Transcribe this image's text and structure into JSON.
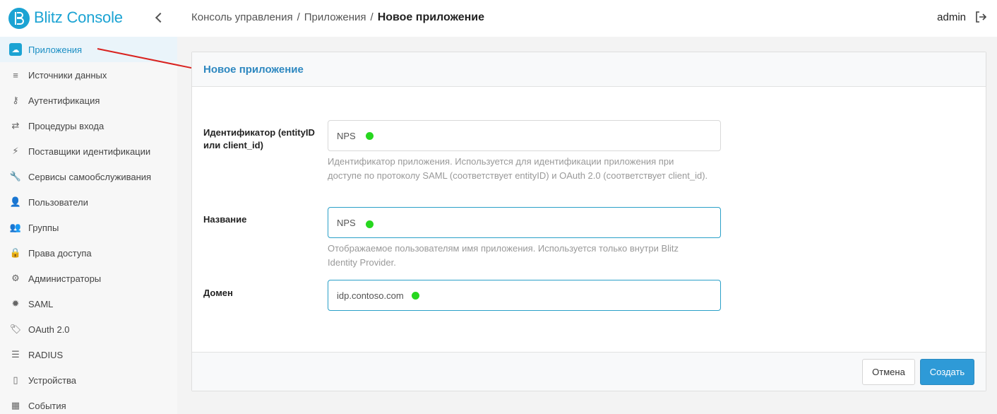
{
  "brand": {
    "name": "Blitz Console"
  },
  "sidebar": {
    "items": [
      {
        "label": "Приложения",
        "icon": "cloud-icon",
        "glyph": "☁",
        "active": true
      },
      {
        "label": "Источники данных",
        "icon": "database-icon",
        "glyph": "≡"
      },
      {
        "label": "Аутентификация",
        "icon": "key-icon",
        "glyph": "⚷"
      },
      {
        "label": "Процедуры входа",
        "icon": "exchange-icon",
        "glyph": "⇄"
      },
      {
        "label": "Поставщики идентификации",
        "icon": "plug-icon",
        "glyph": "⚡"
      },
      {
        "label": "Сервисы самообслуживания",
        "icon": "wrench-icon",
        "glyph": "🔧"
      },
      {
        "label": "Пользователи",
        "icon": "user-icon",
        "glyph": "👤"
      },
      {
        "label": "Группы",
        "icon": "users-icon",
        "glyph": "👥"
      },
      {
        "label": "Права доступа",
        "icon": "lock-icon",
        "glyph": "🔒"
      },
      {
        "label": "Администраторы",
        "icon": "gear-icon",
        "glyph": "⚙"
      },
      {
        "label": "SAML",
        "icon": "cog-icon",
        "glyph": "✹"
      },
      {
        "label": "OAuth 2.0",
        "icon": "tag-icon",
        "glyph": "🏷"
      },
      {
        "label": "RADIUS",
        "icon": "server-icon",
        "glyph": "☰"
      },
      {
        "label": "Устройства",
        "icon": "mobile-icon",
        "glyph": "▯"
      },
      {
        "label": "События",
        "icon": "calendar-icon",
        "glyph": "▦"
      }
    ]
  },
  "header": {
    "breadcrumb": [
      "Консоль управления",
      "Приложения",
      "Новое приложение"
    ],
    "separator": "/",
    "user": "admin"
  },
  "form": {
    "title": "Новое приложение",
    "fields": [
      {
        "label": "Идентификатор (entityID или client_id)",
        "value": "NPS",
        "help": "Идентификатор приложения. Используется для идентификации приложения при доступе по протоколу SAML (соответствует entityID) и OAuth 2.0 (соответствует client_id)."
      },
      {
        "label": "Название",
        "value": "NPS",
        "help": "Отображаемое пользователям имя приложения. Используется только внутри Blitz Identity Provider."
      },
      {
        "label": "Домен",
        "value": "idp.contoso.com",
        "help": ""
      }
    ],
    "cancel_label": "Отмена",
    "create_label": "Создать"
  },
  "colors": {
    "accent": "#1ba3d3",
    "primary_button": "#2e9ad7",
    "marker_dot": "#27d71f",
    "annotation_arrow": "#d9221f"
  }
}
